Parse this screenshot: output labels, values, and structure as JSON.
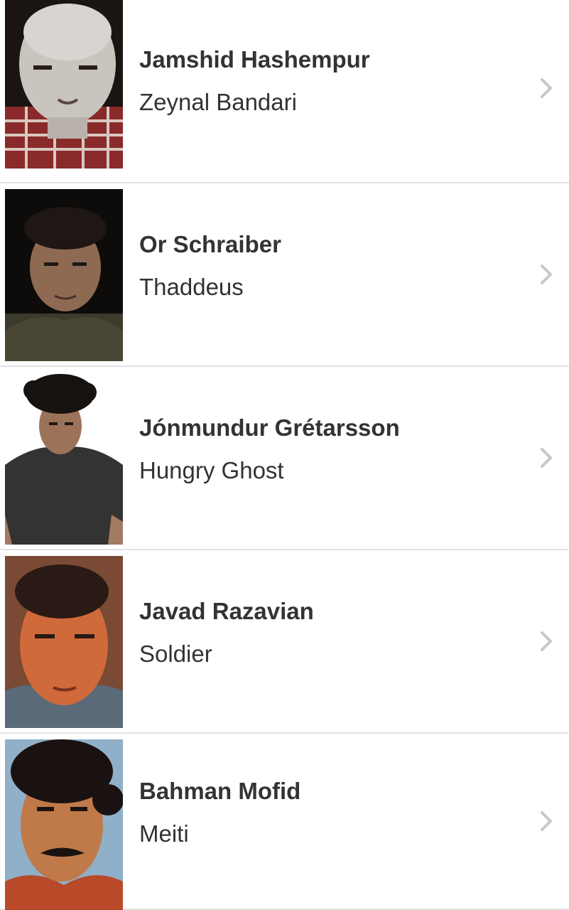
{
  "cast": [
    {
      "name": "Jamshid Hashempur",
      "role": "Zeynal Bandari",
      "photo": "actor-photo"
    },
    {
      "name": "Or Schraiber",
      "role": "Thaddeus",
      "photo": "actor-photo"
    },
    {
      "name": "Jónmundur Grétarsson",
      "role": "Hungry Ghost",
      "photo": "actor-photo"
    },
    {
      "name": "Javad Razavian",
      "role": "Soldier",
      "photo": "actor-photo"
    },
    {
      "name": "Bahman Mofid",
      "role": "Meiti",
      "photo": "actor-photo"
    }
  ],
  "colors": {
    "text": "#333333",
    "divider": "#e3e3e3",
    "chevron": "#c8c8c8"
  }
}
